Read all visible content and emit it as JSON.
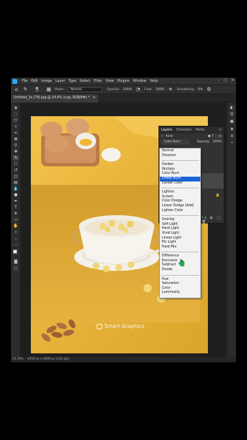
{
  "app": {
    "menu": [
      "File",
      "Edit",
      "Image",
      "Layer",
      "Type",
      "Select",
      "Filter",
      "View",
      "Plugins",
      "Window",
      "Help"
    ]
  },
  "options_bar": {
    "brush_size": "13",
    "mode_label": "Mode:",
    "mode_value": "Normal",
    "opacity_label": "Opacity:",
    "opacity_value": "100%",
    "flow_label": "Flow:",
    "flow_value": "100%",
    "smoothing_label": "Smoothing:",
    "smoothing_value": "0%"
  },
  "document": {
    "tab_title": "Untitled_3x (74).jpg @ 24.4% (cup, RGB/8#) *",
    "watermark": "Smart Graphics"
  },
  "status": {
    "zoom": "24.39%",
    "info": "3456 px x 4608 px (316 ppi)"
  },
  "layers_panel": {
    "tabs": [
      "Layers",
      "Channels",
      "Paths"
    ],
    "search_placeholder": "Kind",
    "blend_mode": "Color Burn",
    "opacity_label": "Opacity:",
    "opacity_value": "100%"
  },
  "blend_menu": {
    "groups": [
      [
        "Normal",
        "Dissolve"
      ],
      [
        "Darken",
        "Multiply",
        "Color Burn",
        "Linear Burn",
        "Darker Color"
      ],
      [
        "Lighten",
        "Screen",
        "Color Dodge",
        "Linear Dodge (Add)",
        "Lighter Color"
      ],
      [
        "Overlay",
        "Soft Light",
        "Hard Light",
        "Vivid Light",
        "Linear Light",
        "Pin Light",
        "Hard Mix"
      ],
      [
        "Difference",
        "Exclusion",
        "Subtract",
        "Divide"
      ],
      [
        "Hue",
        "Saturation",
        "Color",
        "Luminosity"
      ]
    ],
    "highlighted": "Linear Burn"
  }
}
